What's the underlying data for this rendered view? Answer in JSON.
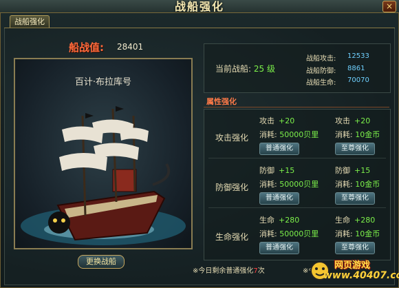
{
  "window": {
    "title": "战船强化",
    "close": "×"
  },
  "tab": {
    "label": "战船强化"
  },
  "power": {
    "label": "船战值:",
    "value": "28401"
  },
  "ship": {
    "name": "百计·布拉库号"
  },
  "change_button": "更换战船",
  "current": {
    "label": "当前战船:",
    "level": "25 级"
  },
  "stats": [
    {
      "label": "战船攻击:",
      "value": "12533"
    },
    {
      "label": "战船防御:",
      "value": "8861"
    },
    {
      "label": "战船生命:",
      "value": "70070"
    }
  ],
  "attr_title": "属性强化",
  "rows": [
    {
      "label": "攻击强化",
      "normal": {
        "stat": "攻击",
        "inc": "+20",
        "cost_label": "消耗:",
        "cost": "50000贝里",
        "button": "普通强化"
      },
      "supreme": {
        "stat": "攻击",
        "inc": "+20",
        "cost_label": "消耗:",
        "cost": "10金币",
        "button": "至尊强化"
      }
    },
    {
      "label": "防御强化",
      "normal": {
        "stat": "防御",
        "inc": "+15",
        "cost_label": "消耗:",
        "cost": "50000贝里",
        "button": "普通强化"
      },
      "supreme": {
        "stat": "防御",
        "inc": "+15",
        "cost_label": "消耗:",
        "cost": "10金币",
        "button": "至尊强化"
      }
    },
    {
      "label": "生命强化",
      "normal": {
        "stat": "生命",
        "inc": "+280",
        "cost_label": "消耗:",
        "cost": "50000贝里",
        "button": "普通强化"
      },
      "supreme": {
        "stat": "生命",
        "inc": "+280",
        "cost_label": "消耗:",
        "cost": "10金币",
        "button": "至尊强化"
      }
    }
  ],
  "remaining": {
    "prefix": "※今日剩余普通强化",
    "count": "7",
    "suffix": "次"
  },
  "remaining2": "※今",
  "watermark": {
    "top": "网页游戏",
    "bottom": "www.40407.com"
  },
  "colors": {
    "accent_orange": "#ff6a3c",
    "green_value": "#7cf04a",
    "blue_value": "#6fd0ff"
  }
}
